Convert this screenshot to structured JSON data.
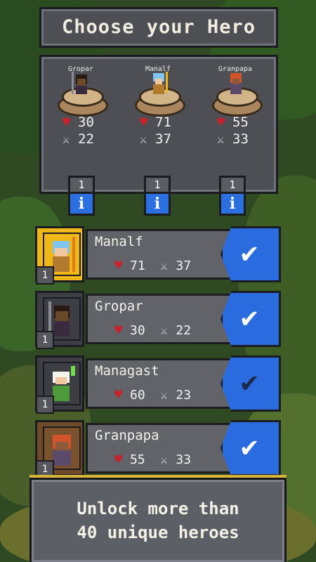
{
  "title": "Choose your Hero",
  "selected_heroes": [
    {
      "name": "Gropar",
      "hp": "30",
      "attack": "22",
      "level": "1",
      "info_icon": "info-icon",
      "color": "#6b4a2a"
    },
    {
      "name": "Manalf",
      "hp": "71",
      "attack": "37",
      "level": "1",
      "info_icon": "info-icon",
      "color": "#7ec6f0"
    },
    {
      "name": "Granpapa",
      "hp": "55",
      "attack": "33",
      "level": "1",
      "info_icon": "info-icon",
      "color": "#d2542b"
    }
  ],
  "hero_list": [
    {
      "name": "Manalf",
      "hp": "71",
      "attack": "37",
      "level": "1",
      "selected": true,
      "card_color": "#f0b816",
      "check_icon": "check-icon"
    },
    {
      "name": "Gropar",
      "hp": "30",
      "attack": "22",
      "level": "1",
      "selected": true,
      "card_color": "#3c3e43",
      "check_icon": "check-icon"
    },
    {
      "name": "Managast",
      "hp": "60",
      "attack": "23",
      "level": "1",
      "selected": false,
      "card_color": "#3c3e43",
      "check_icon": "check-icon"
    },
    {
      "name": "Granpapa",
      "hp": "55",
      "attack": "33",
      "level": "1",
      "selected": true,
      "card_color": "#6e4a2a",
      "check_icon": "check-icon"
    }
  ],
  "footer": {
    "line1": "Unlock more than",
    "line2": "40 unique heroes"
  },
  "colors": {
    "heart": "#c8212b",
    "check_blue": "#2b6be0",
    "panel": "#4d4f55"
  }
}
